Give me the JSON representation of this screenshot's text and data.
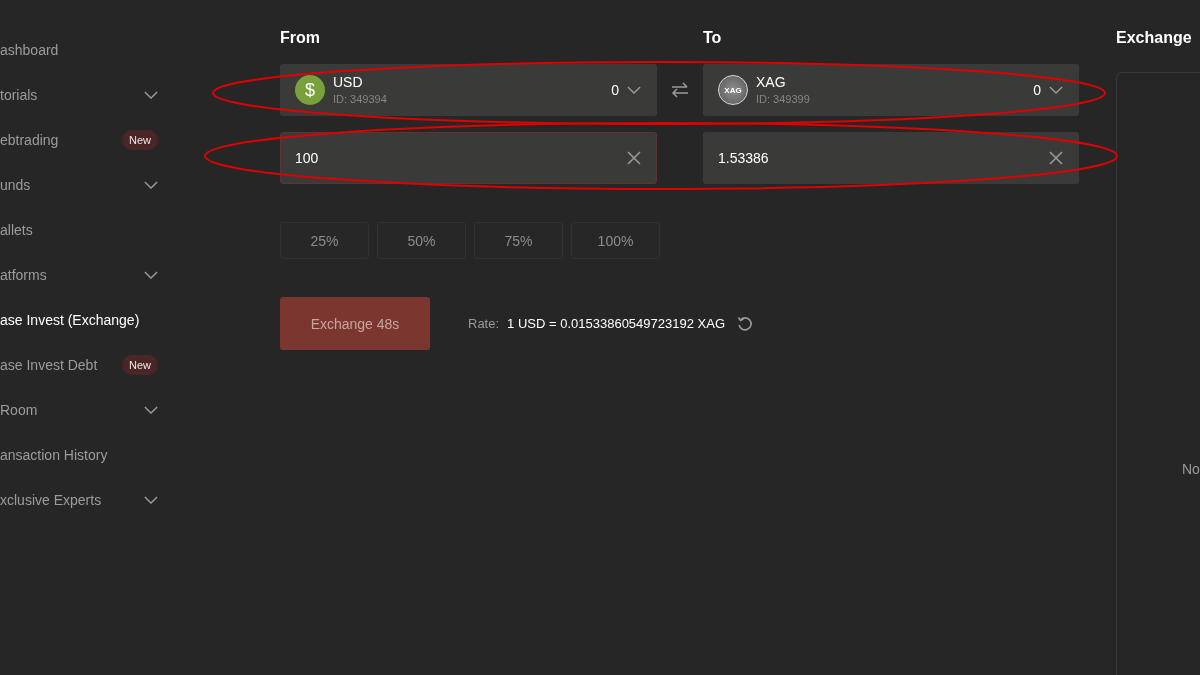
{
  "sidebar": {
    "items": [
      {
        "label": "ashboard",
        "kind": "link",
        "selected": false
      },
      {
        "label": "torials",
        "kind": "group",
        "selected": false
      },
      {
        "label": "ebtrading",
        "kind": "link",
        "selected": false,
        "badge": "New"
      },
      {
        "label": "unds",
        "kind": "group",
        "selected": false
      },
      {
        "label": "allets",
        "kind": "link",
        "selected": false
      },
      {
        "label": "atforms",
        "kind": "group",
        "selected": false
      },
      {
        "label": "ase Invest (Exchange)",
        "kind": "link",
        "selected": true
      },
      {
        "label": "ase Invest Debt",
        "kind": "link",
        "selected": false,
        "badge": "New"
      },
      {
        "label": "Room",
        "kind": "group",
        "selected": false
      },
      {
        "label": "ansaction History",
        "kind": "link",
        "selected": false
      },
      {
        "label": "xclusive Experts",
        "kind": "group",
        "selected": false
      }
    ]
  },
  "exchange_form": {
    "from_label": "From",
    "to_label": "To",
    "currency_row": {
      "highlighted": true,
      "from": {
        "icon": {
          "kind": "dollar",
          "text": "$"
        },
        "code": "USD",
        "id": "ID: 349394",
        "balance": "0"
      },
      "to": {
        "icon": {
          "kind": "silver",
          "text": "XAG"
        },
        "code": "XAG",
        "id": "ID: 349399",
        "balance": "0"
      }
    },
    "amount_row": {
      "highlighted": true,
      "from": {
        "value": "100",
        "focused": true
      },
      "to": {
        "value": "1.53386",
        "focused": false
      }
    },
    "percent_buttons": [
      "25%",
      "50%",
      "75%",
      "100%"
    ],
    "exchange_button": {
      "label": "Exchange 48s",
      "disabled": true
    },
    "rate": {
      "label": "Rate:",
      "value": "1 USD = 0.01533860549723192 XAG"
    }
  },
  "history_panel": {
    "title": "Exchange",
    "message": "No"
  }
}
